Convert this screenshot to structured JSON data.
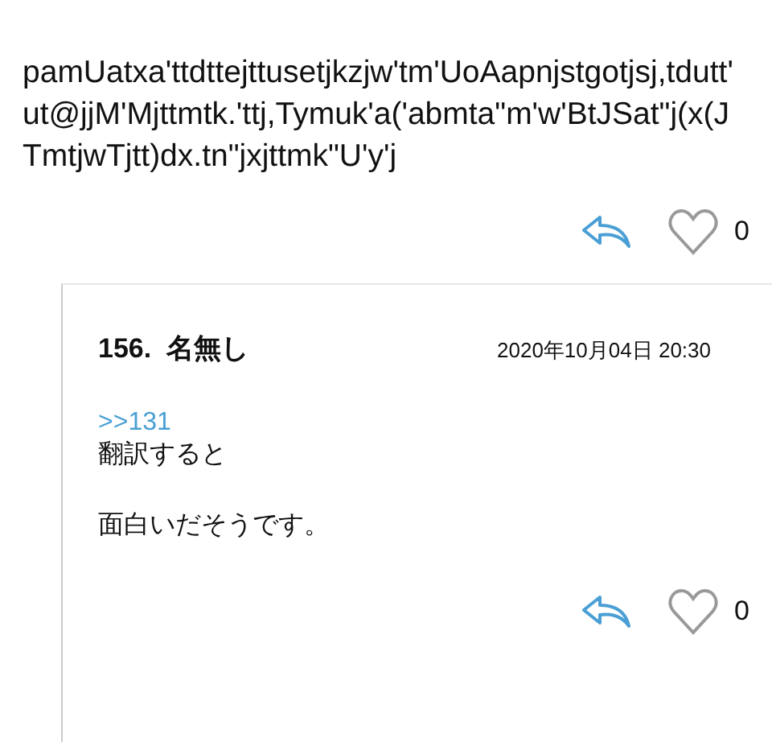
{
  "post": {
    "lines": [
      "pamUatxa'ttdttejttusetjkzjw'tm'UoAapnjstgotjsj,tdutt'",
      "ut@jjM'Mjttmtk.'ttj,Tymuk'a('abmta\"m'w'BtJSat\"j(x(J",
      "TmtjwTjtt)dx.tn\"jxjttmk\"U'y'j"
    ],
    "likes": "0",
    "liked": false
  },
  "reply": {
    "number": "156.",
    "name": "名無し",
    "date": "2020年10月04日 20:30",
    "anchor": ">>131",
    "paragraphs": [
      "翻訳すると",
      "面白いだそうです。"
    ],
    "likes": "0",
    "liked": false
  }
}
